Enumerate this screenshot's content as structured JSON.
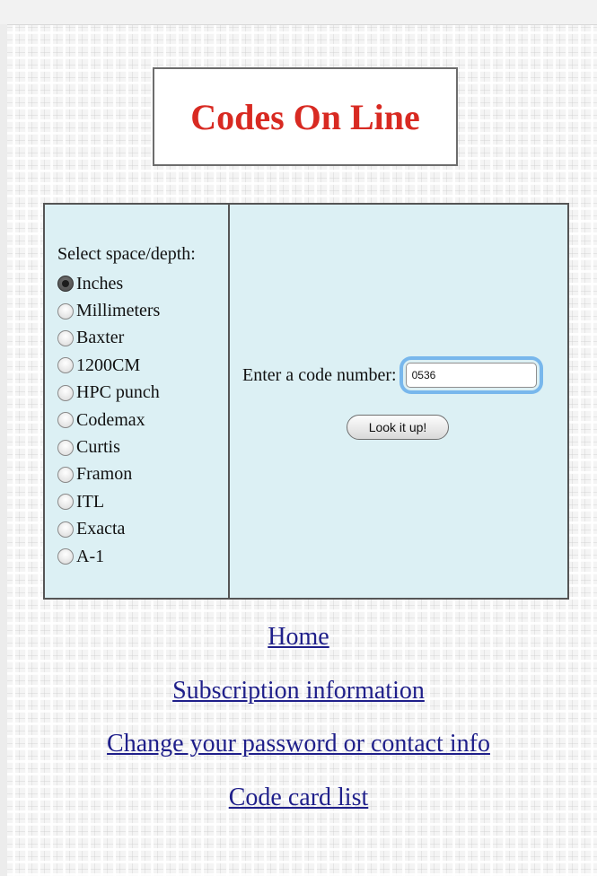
{
  "header": {
    "title": "Codes On Line",
    "title_color": "#d82a22"
  },
  "form": {
    "select_label": "Select space/depth:",
    "selected": "Inches",
    "options": [
      "Inches",
      "Millimeters",
      "Baxter",
      "1200CM",
      "HPC punch",
      "Codemax",
      "Curtis",
      "Framon",
      "ITL",
      "Exacta",
      "A-1"
    ],
    "code_label": "Enter a code number:",
    "code_value": "0536",
    "lookup_button": "Look it up!"
  },
  "links": [
    "Home",
    "Subscription information",
    "Change your password or contact info",
    "Code card list"
  ],
  "colors": {
    "panel_bg": "#dcf0f4",
    "link": "#1f1f8a",
    "focus_ring": "#78b7ec"
  }
}
